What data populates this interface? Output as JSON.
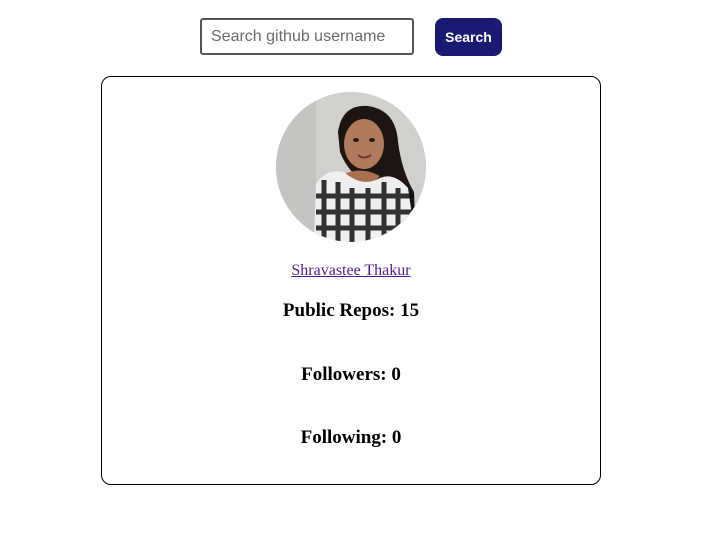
{
  "search": {
    "placeholder": "Search github username",
    "value": "",
    "button_label": "Search"
  },
  "profile": {
    "name": "Shravastee Thakur",
    "public_repos_text": "Public Repos: 15",
    "followers_text": "Followers: 0",
    "following_text": "Following: 0",
    "public_repos": 15,
    "followers": 0,
    "following": 0
  },
  "colors": {
    "button_bg": "#1a1a72",
    "button_text": "#ffffff",
    "link": "#551a8b",
    "card_border": "#000000"
  }
}
